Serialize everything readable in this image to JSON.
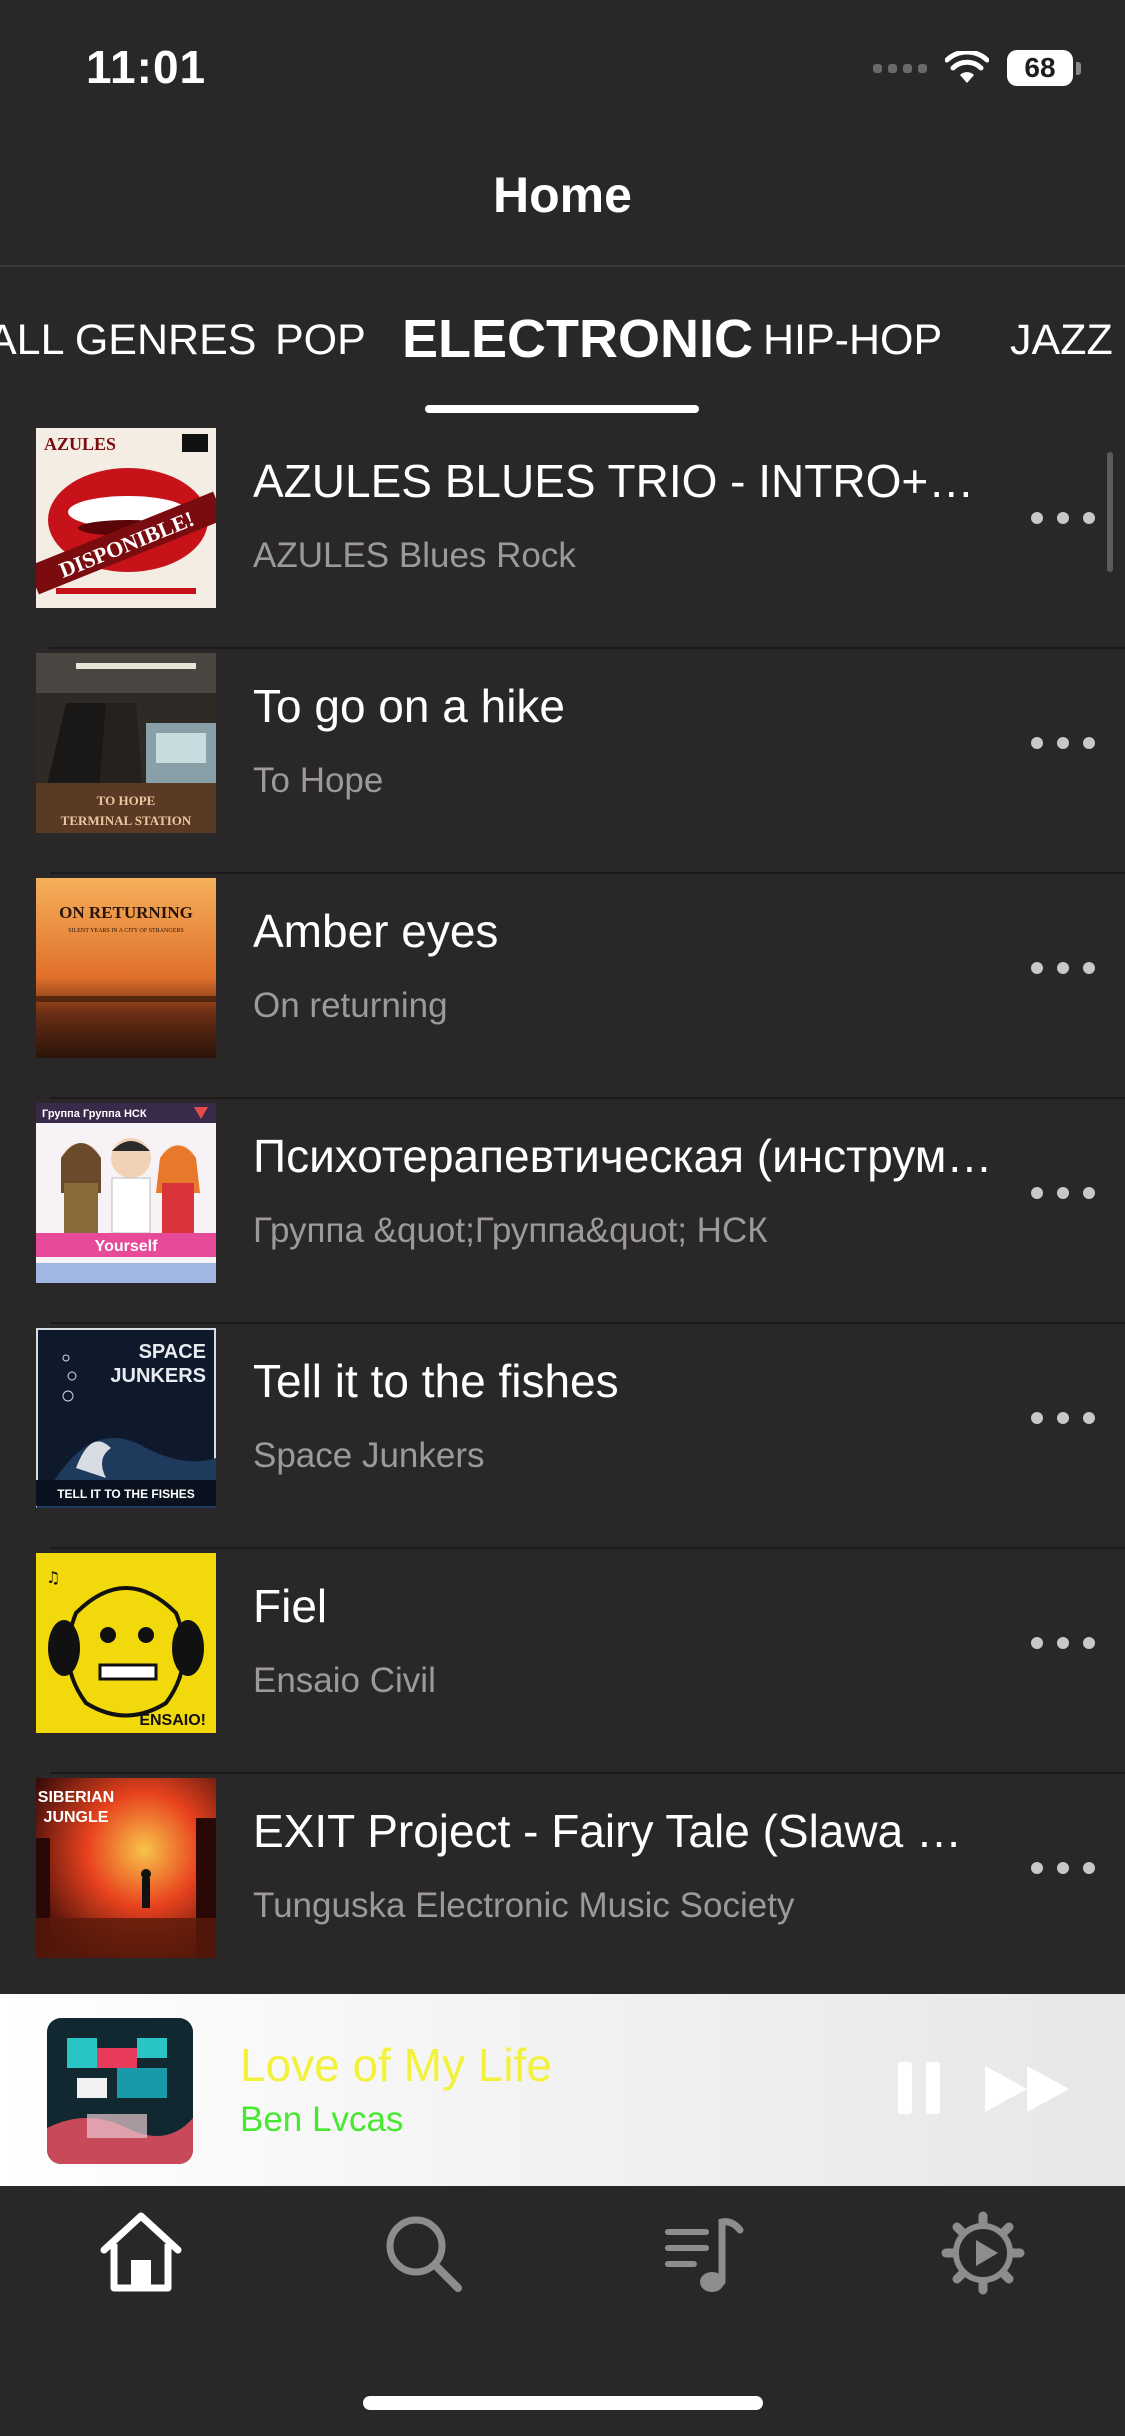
{
  "status_bar": {
    "time": "11:01",
    "battery": "68"
  },
  "header": {
    "title": "Home"
  },
  "genres": [
    {
      "label": "ALL GENRES",
      "active": false
    },
    {
      "label": "POP",
      "active": false
    },
    {
      "label": "ELECTRONIC",
      "active": true
    },
    {
      "label": "HIP-HOP",
      "active": false
    },
    {
      "label": "JAZZ",
      "active": false
    }
  ],
  "songs": [
    {
      "title": "AZULES BLUES TRIO - INTRO+BLUES",
      "artist": "AZULES Blues Rock",
      "art": {
        "name": "album-art-disponible",
        "top_text": "AZULES",
        "bottom_text": "DISPONIBLE!",
        "colors": [
          "#f4ede4",
          "#d0141c",
          "#7a0c10"
        ]
      }
    },
    {
      "title": "To go on a hike",
      "artist": "To Hope",
      "art": {
        "name": "album-art-terminal-station",
        "top_text": "TO HOPE",
        "bottom_text": "TERMINAL STATION",
        "colors": [
          "#3d3a34",
          "#8a6a4a",
          "#c9c3b4"
        ]
      }
    },
    {
      "title": "Amber eyes",
      "artist": "On returning",
      "art": {
        "name": "album-art-on-returning",
        "top_text": "ON RETURNING",
        "bottom_text": "SILENT YEARS IN A CITY OF STRANGERS",
        "colors": [
          "#f2a146",
          "#e0702a",
          "#3a1e12"
        ]
      }
    },
    {
      "title": "Психотерапевтическая (инструментальная)",
      "artist": "Группа &quot;Группа&quot; НСК",
      "art": {
        "name": "album-art-yourself",
        "top_text": "Группа Группа НСК",
        "bottom_text": "Yourself",
        "colors": [
          "#f4f0f4",
          "#e84a9a",
          "#4c7ad0"
        ]
      }
    },
    {
      "title": "Tell it to the fishes",
      "artist": "Space Junkers",
      "art": {
        "name": "album-art-space-junkers",
        "top_text": "SPACE JUNKERS",
        "bottom_text": "TELL IT TO THE FISHES",
        "colors": [
          "#0e1a2c",
          "#1e3a5c",
          "#d8dde4"
        ]
      }
    },
    {
      "title": "Fiel",
      "artist": "Ensaio Civil",
      "art": {
        "name": "album-art-ensaio",
        "top_text": "",
        "bottom_text": "ENSAIO!",
        "colors": [
          "#f2d90c",
          "#111111",
          "#f2d90c"
        ]
      }
    },
    {
      "title": "EXIT Project - Fairy Tale (Slawa Remix)",
      "artist": "Tunguska Electronic Music Society",
      "art": {
        "name": "album-art-siberian-jungle",
        "top_text": "SIBERIAN JUNGLE",
        "bottom_text": "",
        "colors": [
          "#e8421e",
          "#f6a43a",
          "#3a0c08"
        ]
      }
    }
  ],
  "now_playing": {
    "title": "Love of My Life",
    "artist": "Ben Lvcas",
    "title_color": "#f2f23c",
    "artist_color": "#48e832"
  },
  "tab_bar": [
    {
      "name": "home-icon",
      "active": true
    },
    {
      "name": "search-icon",
      "active": false
    },
    {
      "name": "playlist-icon",
      "active": false
    },
    {
      "name": "settings-icon",
      "active": false
    }
  ]
}
